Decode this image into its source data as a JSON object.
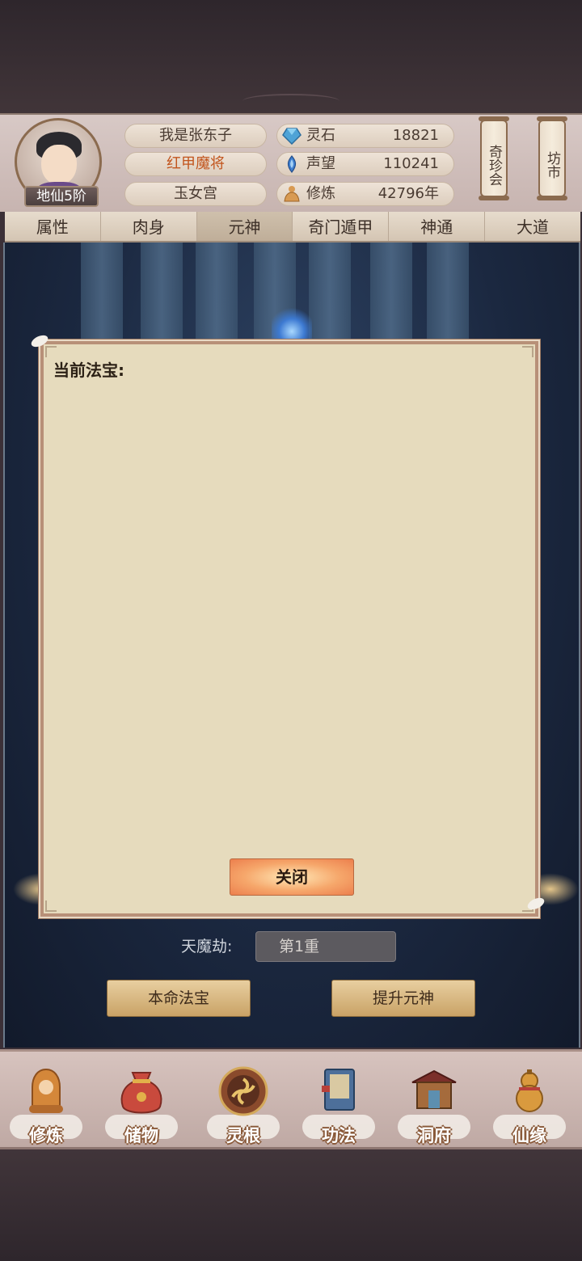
{
  "player": {
    "realm_badge": "地仙5阶",
    "name": "我是张东子",
    "title": "红甲魔将",
    "sect": "玉女宫"
  },
  "resources": [
    {
      "icon": "spirit-stone-icon",
      "label": "灵石",
      "value": "18821"
    },
    {
      "icon": "reputation-icon",
      "label": "声望",
      "value": "110241"
    },
    {
      "icon": "cultivation-icon",
      "label": "修炼",
      "value": "42796年"
    }
  ],
  "side_buttons": {
    "treasure_fair": "奇珍会",
    "market": "坊市"
  },
  "tabs": [
    {
      "label": "属性",
      "active": false
    },
    {
      "label": "肉身",
      "active": false
    },
    {
      "label": "元神",
      "active": true
    },
    {
      "label": "奇门遁甲",
      "active": false
    },
    {
      "label": "神通",
      "active": false
    },
    {
      "label": "大道",
      "active": false
    }
  ],
  "scene": {
    "tribulation_label": "天魔劫:",
    "tribulation_value": "第1重",
    "buttons": {
      "natal_treasure": "本命法宝",
      "upgrade_spirit": "提升元神"
    }
  },
  "modal": {
    "title": "当前法宝:",
    "close_label": "关闭"
  },
  "bottom_nav": [
    {
      "label": "修炼",
      "icon": "meditation-icon"
    },
    {
      "label": "储物",
      "icon": "storage-bag-icon"
    },
    {
      "label": "灵根",
      "icon": "spirit-root-icon"
    },
    {
      "label": "功法",
      "icon": "scripture-book-icon"
    },
    {
      "label": "洞府",
      "icon": "cave-house-icon"
    },
    {
      "label": "仙缘",
      "icon": "gourd-icon"
    }
  ],
  "colors": {
    "title_orange": "#c2551d",
    "modal_bg": "#e6dbbd",
    "scene_blue": "#1b2840",
    "close_button": "#ec7f4d"
  }
}
